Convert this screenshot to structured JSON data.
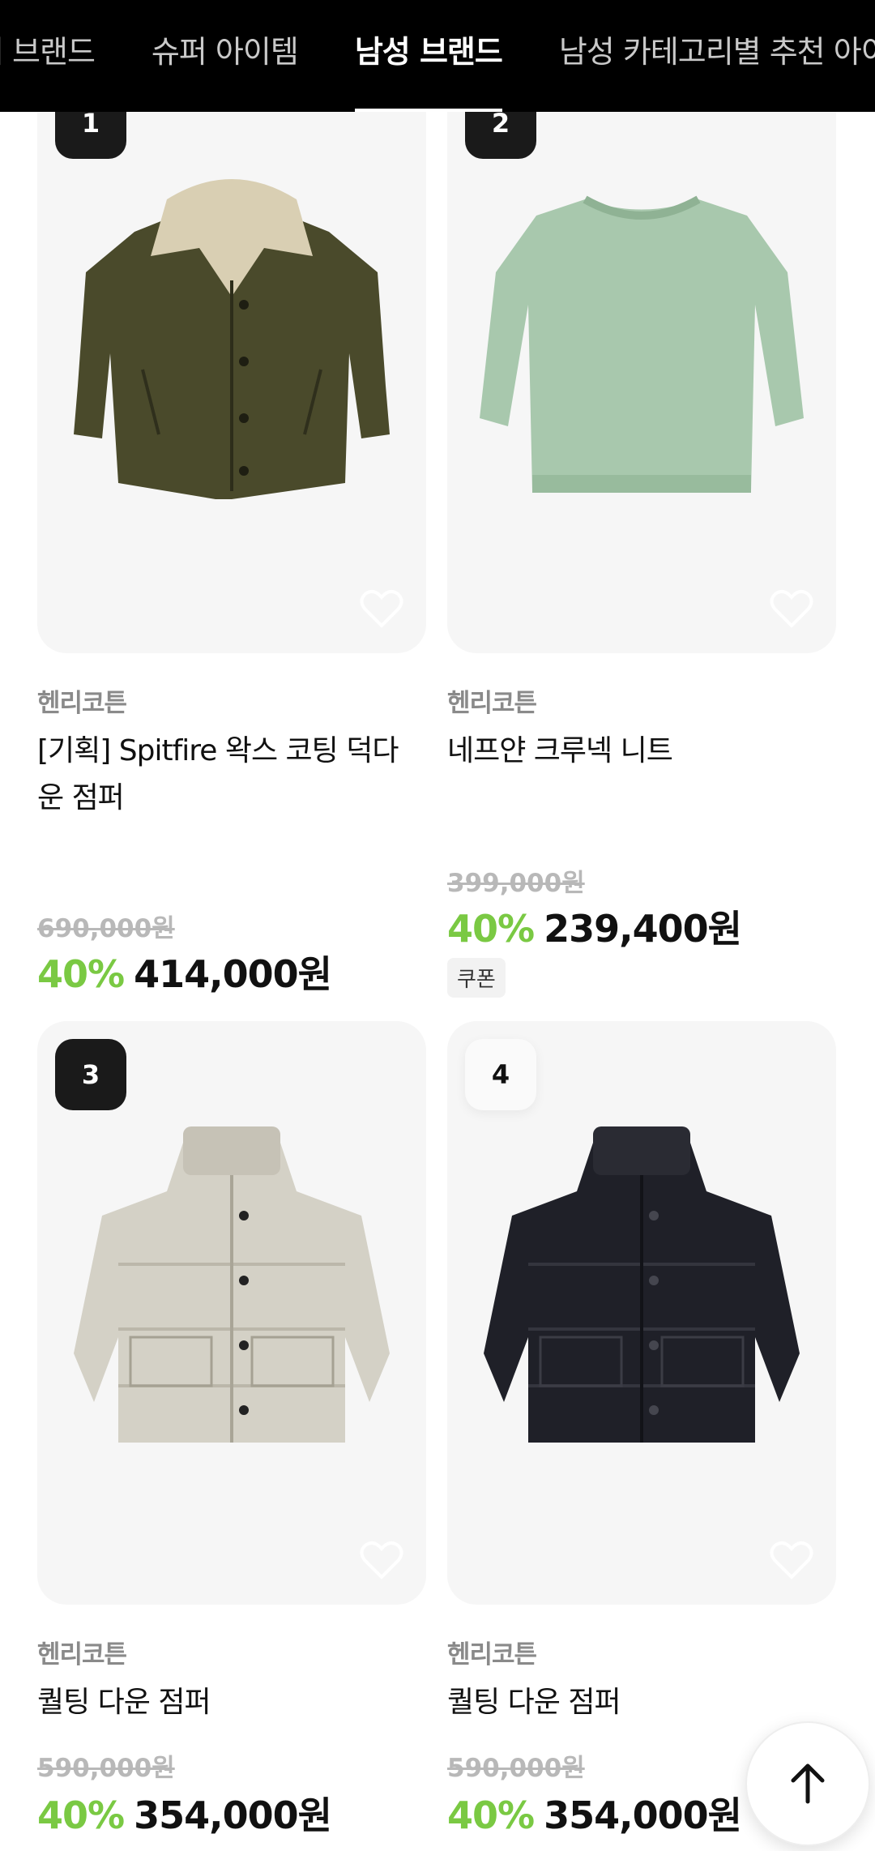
{
  "tabs": [
    {
      "label": "퍼 브랜드",
      "active": false
    },
    {
      "label": "슈퍼 아이템",
      "active": false
    },
    {
      "label": "남성 브랜드",
      "active": true
    },
    {
      "label": "남성 카테고리별 추천 아이",
      "active": false
    }
  ],
  "products": [
    {
      "rank": "1",
      "brand": "헨리코튼",
      "name": "[기획] Spitfire 왁스 코팅 덕다운 점퍼",
      "original_price": "690,000원",
      "discount": "40%",
      "price": "414,000원",
      "coupon": null,
      "image_icon": "olive-jacket-image"
    },
    {
      "rank": "2",
      "brand": "헨리코튼",
      "name": "네프얀 크루넥 니트",
      "original_price": "399,000원",
      "discount": "40%",
      "price": "239,400원",
      "coupon": "쿠폰",
      "image_icon": "green-knit-image"
    },
    {
      "rank": "3",
      "brand": "헨리코튼",
      "name": "퀄팅 다운 점퍼",
      "original_price": "590,000원",
      "discount": "40%",
      "price": "354,000원",
      "coupon": null,
      "image_icon": "beige-puffer-image"
    },
    {
      "rank": "4",
      "brand": "헨리코튼",
      "name": "퀄팅 다운 점퍼",
      "original_price": "590,000원",
      "discount": "40%",
      "price": "354,000원",
      "coupon": null,
      "image_icon": "black-puffer-image"
    }
  ],
  "colors": {
    "header_bg": "#000000",
    "discount": "#7ac943",
    "card_bg": "#f6f6f6"
  },
  "scroll_top_icon": "arrow-up-icon"
}
